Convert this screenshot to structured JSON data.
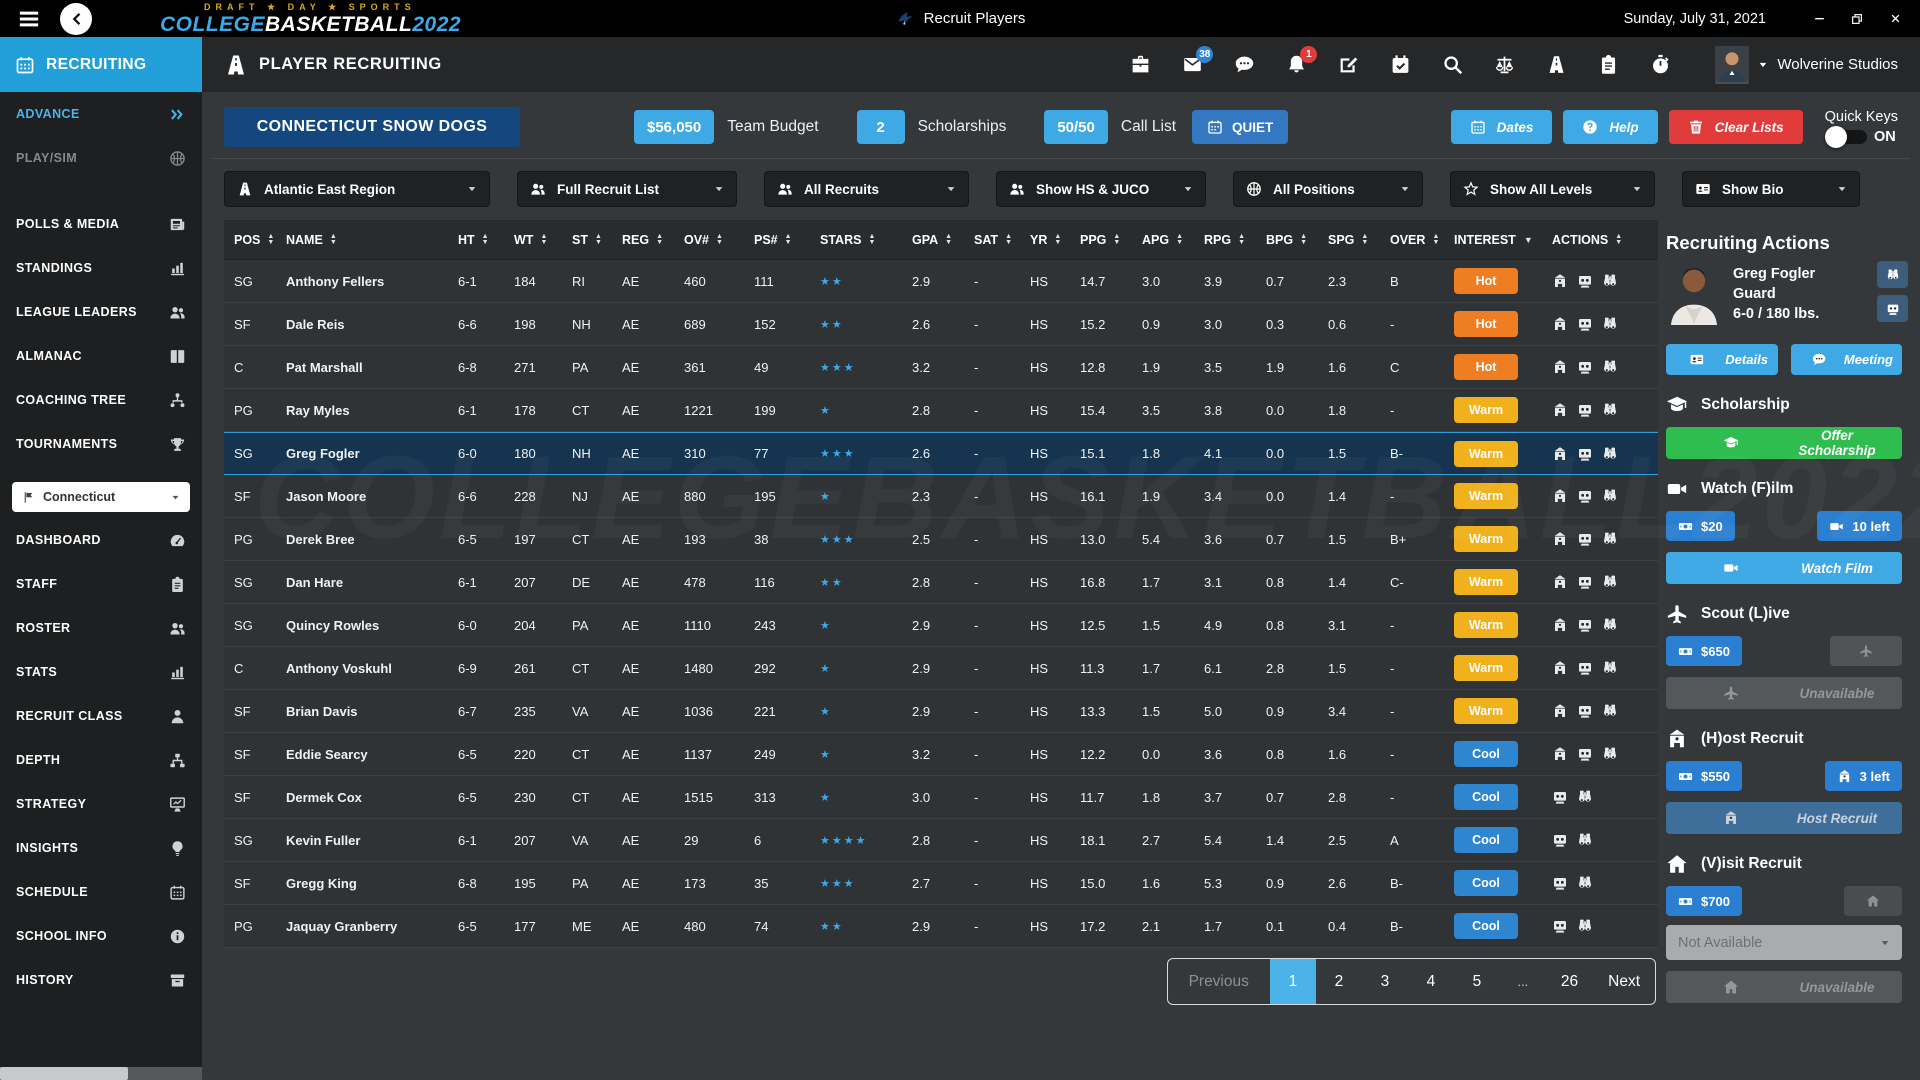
{
  "titlebar": {
    "title": "Recruit Players",
    "date": "Sunday, July 31, 2021",
    "logo": {
      "tagline": "DRAFT ★ DAY ★ SPORTS",
      "college": "COLLEGE",
      "basketball": "BASKETBALL",
      "year": "2022"
    }
  },
  "sidebar": {
    "active_tab": "RECRUITING",
    "items": [
      {
        "label": "ADVANCE",
        "icon": "chevrons-right",
        "variant": "advance"
      },
      {
        "label": "PLAY/SIM",
        "icon": "basketball",
        "variant": "muted"
      },
      {
        "label": "POLLS & MEDIA",
        "icon": "newspaper",
        "gap": true
      },
      {
        "label": "STANDINGS",
        "icon": "chart-bars"
      },
      {
        "label": "LEAGUE LEADERS",
        "icon": "users"
      },
      {
        "label": "ALMANAC",
        "icon": "book"
      },
      {
        "label": "COACHING TREE",
        "icon": "tree"
      },
      {
        "label": "TOURNAMENTS",
        "icon": "trophy"
      },
      {
        "type": "select",
        "value": "Connecticut",
        "icon": "flag"
      },
      {
        "label": "DASHBOARD",
        "icon": "gauge"
      },
      {
        "label": "STAFF",
        "icon": "clipboard"
      },
      {
        "label": "ROSTER",
        "icon": "users"
      },
      {
        "label": "STATS",
        "icon": "chart-bars"
      },
      {
        "label": "RECRUIT CLASS",
        "icon": "person"
      },
      {
        "label": "DEPTH",
        "icon": "sitemap"
      },
      {
        "label": "STRATEGY",
        "icon": "strategy"
      },
      {
        "label": "INSIGHTS",
        "icon": "lightbulb"
      },
      {
        "label": "SCHEDULE",
        "icon": "calendar"
      },
      {
        "label": "SCHOOL INFO",
        "icon": "info"
      },
      {
        "label": "HISTORY",
        "icon": "archive"
      }
    ]
  },
  "header": {
    "section_title": "PLAYER RECRUITING",
    "icons": [
      {
        "icon": "briefcase"
      },
      {
        "icon": "envelope",
        "badge": "38",
        "badge_color": "#2e86d1"
      },
      {
        "icon": "chat"
      },
      {
        "icon": "bell",
        "badge": "1",
        "badge_color": "#e23b3b"
      },
      {
        "icon": "edit"
      },
      {
        "icon": "calendar-check"
      },
      {
        "icon": "search"
      },
      {
        "icon": "scales"
      },
      {
        "icon": "road"
      },
      {
        "icon": "clipboard"
      },
      {
        "icon": "stopwatch"
      }
    ],
    "account": "Wolverine Studios"
  },
  "team_bar": {
    "team_name": "CONNECTICUT SNOW DOGS",
    "stats": [
      {
        "value": "$56,050",
        "label": "Team Budget"
      },
      {
        "value": "2",
        "label": "Scholarships"
      },
      {
        "value": "50/50",
        "label": "Call List"
      }
    ],
    "quiet_label": "QUIET",
    "actions": [
      {
        "icon": "calendar",
        "label": "Dates",
        "style": "sky"
      },
      {
        "icon": "question",
        "label": "Help",
        "style": "sky"
      },
      {
        "icon": "trash",
        "label": "Clear Lists",
        "style": "red"
      }
    ],
    "quick_keys": {
      "label": "Quick Keys",
      "state": "ON"
    }
  },
  "filters": [
    {
      "icon": "road",
      "label": "Atlantic East Region"
    },
    {
      "icon": "users",
      "label": "Full Recruit List"
    },
    {
      "icon": "users",
      "label": "All Recruits"
    },
    {
      "icon": "users",
      "label": "Show HS & JUCO"
    },
    {
      "icon": "basketball",
      "label": "All Positions"
    },
    {
      "icon": "star-outline",
      "label": "Show All Levels"
    },
    {
      "icon": "id-card",
      "label": "Show Bio"
    }
  ],
  "table": {
    "watermark": "COLLEGEBASKETBALL2022",
    "columns": [
      {
        "label": "POS",
        "sort": "both"
      },
      {
        "label": "NAME",
        "sort": "both"
      },
      {
        "label": "HT",
        "sort": "both"
      },
      {
        "label": "WT",
        "sort": "both"
      },
      {
        "label": "ST",
        "sort": "both"
      },
      {
        "label": "REG",
        "sort": "both"
      },
      {
        "label": "OV#",
        "sort": "both"
      },
      {
        "label": "PS#",
        "sort": "both"
      },
      {
        "label": "STARS",
        "sort": "both"
      },
      {
        "label": "GPA",
        "sort": "both"
      },
      {
        "label": "SAT",
        "sort": "both"
      },
      {
        "label": "YR",
        "sort": "both"
      },
      {
        "label": "PPG",
        "sort": "both"
      },
      {
        "label": "APG",
        "sort": "both"
      },
      {
        "label": "RPG",
        "sort": "both"
      },
      {
        "label": "BPG",
        "sort": "both"
      },
      {
        "label": "SPG",
        "sort": "both"
      },
      {
        "label": "OVER",
        "sort": "both"
      },
      {
        "label": "INTEREST",
        "sort": "down"
      },
      {
        "label": "ACTIONS",
        "sort": "both"
      }
    ],
    "interest_colors": {
      "Hot": "#ef7d22",
      "Warm": "#f0b11c",
      "Cool": "#2e86d1"
    },
    "rows": [
      {
        "pos": "SG",
        "name": "Anthony Fellers",
        "ht": "6-1",
        "wt": "184",
        "st": "RI",
        "reg": "AE",
        "ov": "460",
        "ps": "111",
        "stars": 2,
        "gpa": "2.9",
        "sat": "-",
        "yr": "HS",
        "ppg": "14.7",
        "apg": "3.0",
        "rpg": "3.9",
        "bpg": "0.7",
        "spg": "2.3",
        "over": "B",
        "interest": "Hot",
        "actions": [
          "host",
          "film",
          "scout"
        ]
      },
      {
        "pos": "SF",
        "name": "Dale Reis",
        "ht": "6-6",
        "wt": "198",
        "st": "NH",
        "reg": "AE",
        "ov": "689",
        "ps": "152",
        "stars": 2,
        "gpa": "2.6",
        "sat": "-",
        "yr": "HS",
        "ppg": "15.2",
        "apg": "0.9",
        "rpg": "3.0",
        "bpg": "0.3",
        "spg": "0.6",
        "over": "-",
        "interest": "Hot",
        "actions": [
          "host",
          "film",
          "scout"
        ]
      },
      {
        "pos": "C",
        "name": "Pat Marshall",
        "ht": "6-8",
        "wt": "271",
        "st": "PA",
        "reg": "AE",
        "ov": "361",
        "ps": "49",
        "stars": 3,
        "gpa": "3.2",
        "sat": "-",
        "yr": "HS",
        "ppg": "12.8",
        "apg": "1.9",
        "rpg": "3.5",
        "bpg": "1.9",
        "spg": "1.6",
        "over": "C",
        "interest": "Hot",
        "actions": [
          "host",
          "film",
          "scout"
        ]
      },
      {
        "pos": "PG",
        "name": "Ray Myles",
        "ht": "6-1",
        "wt": "178",
        "st": "CT",
        "reg": "AE",
        "ov": "1221",
        "ps": "199",
        "stars": 1,
        "gpa": "2.8",
        "sat": "-",
        "yr": "HS",
        "ppg": "15.4",
        "apg": "3.5",
        "rpg": "3.8",
        "bpg": "0.0",
        "spg": "1.8",
        "over": "-",
        "interest": "Warm",
        "actions": [
          "host",
          "film",
          "scout"
        ]
      },
      {
        "pos": "SG",
        "name": "Greg Fogler",
        "ht": "6-0",
        "wt": "180",
        "st": "NH",
        "reg": "AE",
        "ov": "310",
        "ps": "77",
        "stars": 3,
        "gpa": "2.6",
        "sat": "-",
        "yr": "HS",
        "ppg": "15.1",
        "apg": "1.8",
        "rpg": "4.1",
        "bpg": "0.0",
        "spg": "1.5",
        "over": "B-",
        "interest": "Warm",
        "actions": [
          "host",
          "film",
          "scout"
        ],
        "selected": true
      },
      {
        "pos": "SF",
        "name": "Jason Moore",
        "ht": "6-6",
        "wt": "228",
        "st": "NJ",
        "reg": "AE",
        "ov": "880",
        "ps": "195",
        "stars": 1,
        "gpa": "2.3",
        "sat": "-",
        "yr": "HS",
        "ppg": "16.1",
        "apg": "1.9",
        "rpg": "3.4",
        "bpg": "0.0",
        "spg": "1.4",
        "over": "-",
        "interest": "Warm",
        "actions": [
          "host",
          "film",
          "scout"
        ]
      },
      {
        "pos": "PG",
        "name": "Derek Bree",
        "ht": "6-5",
        "wt": "197",
        "st": "CT",
        "reg": "AE",
        "ov": "193",
        "ps": "38",
        "stars": 3,
        "gpa": "2.5",
        "sat": "-",
        "yr": "HS",
        "ppg": "13.0",
        "apg": "5.4",
        "rpg": "3.6",
        "bpg": "0.7",
        "spg": "1.5",
        "over": "B+",
        "interest": "Warm",
        "actions": [
          "host",
          "film",
          "scout"
        ]
      },
      {
        "pos": "SG",
        "name": "Dan Hare",
        "ht": "6-1",
        "wt": "207",
        "st": "DE",
        "reg": "AE",
        "ov": "478",
        "ps": "116",
        "stars": 2,
        "gpa": "2.8",
        "sat": "-",
        "yr": "HS",
        "ppg": "16.8",
        "apg": "1.7",
        "rpg": "3.1",
        "bpg": "0.8",
        "spg": "1.4",
        "over": "C-",
        "interest": "Warm",
        "actions": [
          "host",
          "film",
          "scout"
        ]
      },
      {
        "pos": "SG",
        "name": "Quincy Rowles",
        "ht": "6-0",
        "wt": "204",
        "st": "PA",
        "reg": "AE",
        "ov": "1110",
        "ps": "243",
        "stars": 1,
        "gpa": "2.9",
        "sat": "-",
        "yr": "HS",
        "ppg": "12.5",
        "apg": "1.5",
        "rpg": "4.9",
        "bpg": "0.8",
        "spg": "3.1",
        "over": "-",
        "interest": "Warm",
        "actions": [
          "host",
          "film",
          "scout"
        ]
      },
      {
        "pos": "C",
        "name": "Anthony Voskuhl",
        "ht": "6-9",
        "wt": "261",
        "st": "CT",
        "reg": "AE",
        "ov": "1480",
        "ps": "292",
        "stars": 1,
        "gpa": "2.9",
        "sat": "-",
        "yr": "HS",
        "ppg": "11.3",
        "apg": "1.7",
        "rpg": "6.1",
        "bpg": "2.8",
        "spg": "1.5",
        "over": "-",
        "interest": "Warm",
        "actions": [
          "host",
          "film",
          "scout"
        ]
      },
      {
        "pos": "SF",
        "name": "Brian Davis",
        "ht": "6-7",
        "wt": "235",
        "st": "VA",
        "reg": "AE",
        "ov": "1036",
        "ps": "221",
        "stars": 1,
        "gpa": "2.9",
        "sat": "-",
        "yr": "HS",
        "ppg": "13.3",
        "apg": "1.5",
        "rpg": "5.0",
        "bpg": "0.9",
        "spg": "3.4",
        "over": "-",
        "interest": "Warm",
        "actions": [
          "host",
          "film",
          "scout"
        ]
      },
      {
        "pos": "SF",
        "name": "Eddie Searcy",
        "ht": "6-5",
        "wt": "220",
        "st": "CT",
        "reg": "AE",
        "ov": "1137",
        "ps": "249",
        "stars": 1,
        "gpa": "3.2",
        "sat": "-",
        "yr": "HS",
        "ppg": "12.2",
        "apg": "0.0",
        "rpg": "3.6",
        "bpg": "0.8",
        "spg": "1.6",
        "over": "-",
        "interest": "Cool",
        "actions": [
          "host",
          "film",
          "scout"
        ]
      },
      {
        "pos": "SF",
        "name": "Dermek Cox",
        "ht": "6-5",
        "wt": "230",
        "st": "CT",
        "reg": "AE",
        "ov": "1515",
        "ps": "313",
        "stars": 1,
        "gpa": "3.0",
        "sat": "-",
        "yr": "HS",
        "ppg": "11.7",
        "apg": "1.8",
        "rpg": "3.7",
        "bpg": "0.7",
        "spg": "2.8",
        "over": "-",
        "interest": "Cool",
        "actions": [
          "film",
          "scout"
        ]
      },
      {
        "pos": "SG",
        "name": "Kevin Fuller",
        "ht": "6-1",
        "wt": "207",
        "st": "VA",
        "reg": "AE",
        "ov": "29",
        "ps": "6",
        "stars": 4,
        "gpa": "2.8",
        "sat": "-",
        "yr": "HS",
        "ppg": "18.1",
        "apg": "2.7",
        "rpg": "5.4",
        "bpg": "1.4",
        "spg": "2.5",
        "over": "A",
        "interest": "Cool",
        "actions": [
          "film",
          "scout"
        ]
      },
      {
        "pos": "SF",
        "name": "Gregg King",
        "ht": "6-8",
        "wt": "195",
        "st": "PA",
        "reg": "AE",
        "ov": "173",
        "ps": "35",
        "stars": 3,
        "gpa": "2.7",
        "sat": "-",
        "yr": "HS",
        "ppg": "15.0",
        "apg": "1.6",
        "rpg": "5.3",
        "bpg": "0.9",
        "spg": "2.6",
        "over": "B-",
        "interest": "Cool",
        "actions": [
          "film",
          "scout"
        ]
      },
      {
        "pos": "PG",
        "name": "Jaquay Granberry",
        "ht": "6-5",
        "wt": "177",
        "st": "ME",
        "reg": "AE",
        "ov": "480",
        "ps": "74",
        "stars": 2,
        "gpa": "2.9",
        "sat": "-",
        "yr": "HS",
        "ppg": "17.2",
        "apg": "2.1",
        "rpg": "1.7",
        "bpg": "0.1",
        "spg": "0.4",
        "over": "B-",
        "interest": "Cool",
        "actions": [
          "film",
          "scout"
        ]
      }
    ]
  },
  "pagination": {
    "prev": "Previous",
    "pages": [
      "1",
      "2",
      "3",
      "4",
      "5",
      "...",
      "26"
    ],
    "active": "1",
    "next": "Next"
  },
  "panel": {
    "title": "Recruiting Actions",
    "player": {
      "name": "Greg Fogler",
      "position": "Guard",
      "size": "6-0 / 180 lbs."
    },
    "side_buttons": [
      "scout",
      "film"
    ],
    "detail_buttons": [
      {
        "icon": "id-card",
        "label": "Details"
      },
      {
        "icon": "chat",
        "label": "Meeting"
      }
    ],
    "sections": [
      {
        "icon": "grad-cap",
        "title": "Scholarship",
        "action": {
          "style": "green",
          "icon": "grad-cap",
          "label": "Offer Scholarship"
        }
      },
      {
        "icon": "camcorder",
        "title": "Watch (F)ilm",
        "chips": [
          {
            "icon": "banknote",
            "label": "$20"
          },
          {
            "icon": "camcorder",
            "label": "10 left"
          }
        ],
        "action": {
          "style": "sky",
          "icon": "camcorder",
          "label": "Watch Film"
        }
      },
      {
        "icon": "plane",
        "title": "Scout (L)ive",
        "chips": [
          {
            "icon": "banknote",
            "label": "$650"
          },
          {
            "icon": "plane",
            "label": "",
            "disabled": true
          }
        ],
        "action": {
          "style": "disabled",
          "icon": "plane",
          "label": "Unavailable"
        }
      },
      {
        "icon": "school",
        "title": "(H)ost Recruit",
        "chips": [
          {
            "icon": "banknote",
            "label": "$550"
          },
          {
            "icon": "school",
            "label": "3 left"
          }
        ],
        "action": {
          "style": "muted-blue",
          "icon": "school",
          "label": "Host Recruit"
        }
      },
      {
        "icon": "home",
        "title": "(V)isit Recruit",
        "chips": [
          {
            "icon": "banknote",
            "label": "$700"
          },
          {
            "icon": "home",
            "label": "",
            "disabled": true,
            "dark": true
          }
        ],
        "dropdown": "Not Available",
        "action": {
          "style": "disabled",
          "icon": "home",
          "label": "Unavailable"
        }
      }
    ]
  }
}
